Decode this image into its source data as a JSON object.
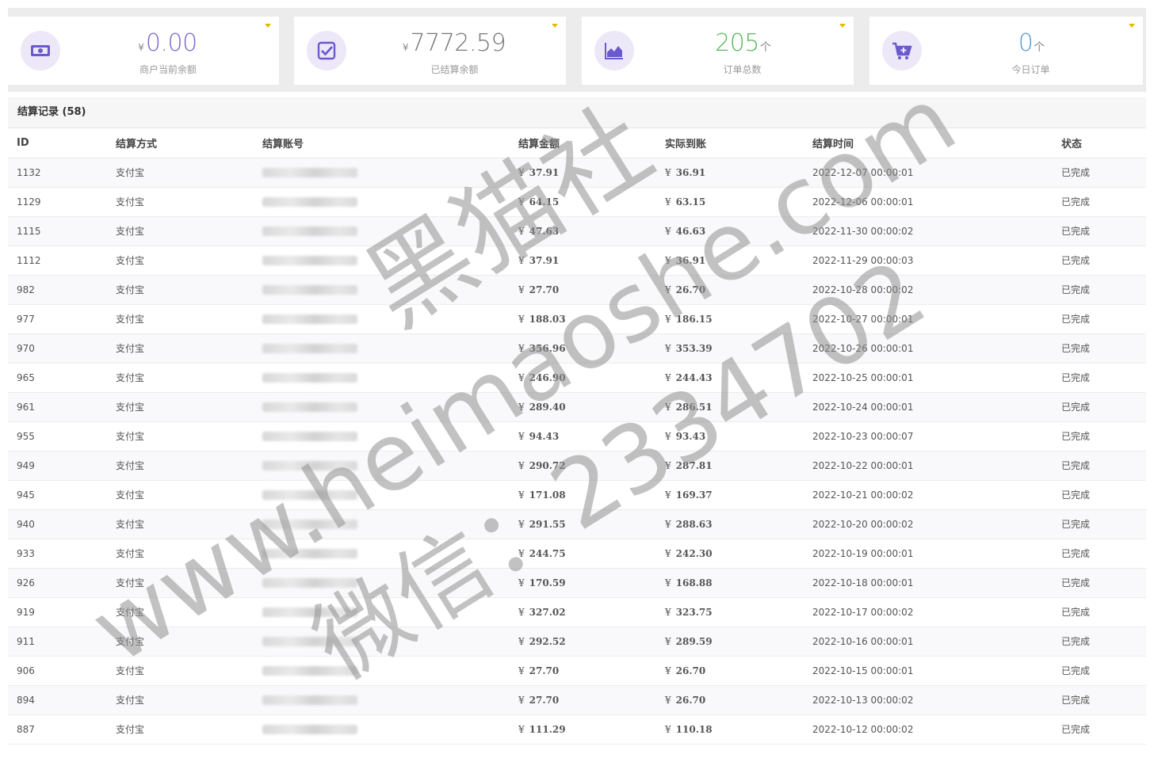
{
  "stats": [
    {
      "prefix": "¥",
      "value": "0.00",
      "suffix": "",
      "label": "商户当前余额",
      "color": "#7b6bcf",
      "icon": "money-icon"
    },
    {
      "prefix": "¥",
      "value": "7772.59",
      "suffix": "",
      "label": "已结算余额",
      "color": "#777777",
      "icon": "check-icon"
    },
    {
      "prefix": "",
      "value": "205",
      "suffix": "个",
      "label": "订单总数",
      "color": "#5cb85c",
      "icon": "area-chart-icon"
    },
    {
      "prefix": "",
      "value": "0",
      "suffix": "个",
      "label": "今日订单",
      "color": "#5b9bd5",
      "icon": "cart-plus-icon"
    }
  ],
  "panel": {
    "title": "结算记录 (58)"
  },
  "table": {
    "headers": {
      "id": "ID",
      "method": "结算方式",
      "account": "结算账号",
      "amount": "结算金额",
      "actual": "实际到账",
      "time": "结算时间",
      "status": "状态"
    },
    "currency": "¥",
    "rows": [
      {
        "id": "1132",
        "method": "支付宝",
        "amount": "37.91",
        "actual": "36.91",
        "time": "2022-12-07 00:00:01",
        "status": "已完成"
      },
      {
        "id": "1129",
        "method": "支付宝",
        "amount": "64.15",
        "actual": "63.15",
        "time": "2022-12-06 00:00:01",
        "status": "已完成"
      },
      {
        "id": "1115",
        "method": "支付宝",
        "amount": "47.63",
        "actual": "46.63",
        "time": "2022-11-30 00:00:02",
        "status": "已完成"
      },
      {
        "id": "1112",
        "method": "支付宝",
        "amount": "37.91",
        "actual": "36.91",
        "time": "2022-11-29 00:00:03",
        "status": "已完成"
      },
      {
        "id": "982",
        "method": "支付宝",
        "amount": "27.70",
        "actual": "26.70",
        "time": "2022-10-28 00:00:02",
        "status": "已完成"
      },
      {
        "id": "977",
        "method": "支付宝",
        "amount": "188.03",
        "actual": "186.15",
        "time": "2022-10-27 00:00:01",
        "status": "已完成"
      },
      {
        "id": "970",
        "method": "支付宝",
        "amount": "356.96",
        "actual": "353.39",
        "time": "2022-10-26 00:00:01",
        "status": "已完成"
      },
      {
        "id": "965",
        "method": "支付宝",
        "amount": "246.90",
        "actual": "244.43",
        "time": "2022-10-25 00:00:01",
        "status": "已完成"
      },
      {
        "id": "961",
        "method": "支付宝",
        "amount": "289.40",
        "actual": "286.51",
        "time": "2022-10-24 00:00:01",
        "status": "已完成"
      },
      {
        "id": "955",
        "method": "支付宝",
        "amount": "94.43",
        "actual": "93.43",
        "time": "2022-10-23 00:00:07",
        "status": "已完成"
      },
      {
        "id": "949",
        "method": "支付宝",
        "amount": "290.72",
        "actual": "287.81",
        "time": "2022-10-22 00:00:01",
        "status": "已完成"
      },
      {
        "id": "945",
        "method": "支付宝",
        "amount": "171.08",
        "actual": "169.37",
        "time": "2022-10-21 00:00:02",
        "status": "已完成"
      },
      {
        "id": "940",
        "method": "支付宝",
        "amount": "291.55",
        "actual": "288.63",
        "time": "2022-10-20 00:00:02",
        "status": "已完成"
      },
      {
        "id": "933",
        "method": "支付宝",
        "amount": "244.75",
        "actual": "242.30",
        "time": "2022-10-19 00:00:01",
        "status": "已完成"
      },
      {
        "id": "926",
        "method": "支付宝",
        "amount": "170.59",
        "actual": "168.88",
        "time": "2022-10-18 00:00:01",
        "status": "已完成"
      },
      {
        "id": "919",
        "method": "支付宝",
        "amount": "327.02",
        "actual": "323.75",
        "time": "2022-10-17 00:00:02",
        "status": "已完成"
      },
      {
        "id": "911",
        "method": "支付宝",
        "amount": "292.52",
        "actual": "289.59",
        "time": "2022-10-16 00:00:01",
        "status": "已完成"
      },
      {
        "id": "906",
        "method": "支付宝",
        "amount": "27.70",
        "actual": "26.70",
        "time": "2022-10-15 00:00:01",
        "status": "已完成"
      },
      {
        "id": "894",
        "method": "支付宝",
        "amount": "27.70",
        "actual": "26.70",
        "time": "2022-10-13 00:00:02",
        "status": "已完成"
      },
      {
        "id": "887",
        "method": "支付宝",
        "amount": "111.29",
        "actual": "110.18",
        "time": "2022-10-12 00:00:02",
        "status": "已完成"
      }
    ]
  },
  "watermark": {
    "line1": "黑猫社",
    "line2": "www.heimaoshe.com",
    "line3": "微信：2334702"
  }
}
